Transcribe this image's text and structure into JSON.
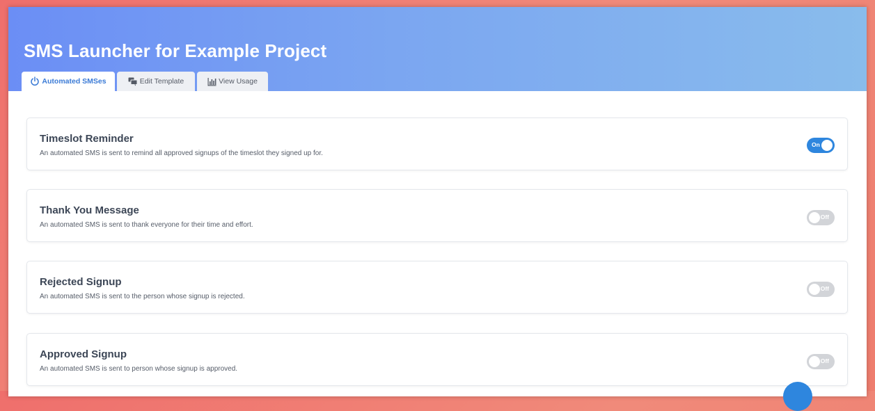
{
  "header": {
    "title": "SMS Launcher for Example Project"
  },
  "tabs": [
    {
      "label": "Automated SMSes",
      "icon": "power-icon",
      "active": true
    },
    {
      "label": "Edit Template",
      "icon": "message-icon",
      "active": false
    },
    {
      "label": "View Usage",
      "icon": "bar-chart-icon",
      "active": false
    }
  ],
  "automations": [
    {
      "title": "Timeslot Reminder",
      "description": "An automated SMS is sent to remind all approved signups of the timeslot they signed up for.",
      "toggle_label": "On",
      "enabled": true
    },
    {
      "title": "Thank You Message",
      "description": "An automated SMS is sent to thank everyone for their time and effort.",
      "toggle_label": "Off",
      "enabled": false
    },
    {
      "title": "Rejected Signup",
      "description": "An automated SMS is sent to the person whose signup is rejected.",
      "toggle_label": "Off",
      "enabled": false
    },
    {
      "title": "Approved Signup",
      "description": "An automated SMS is sent to person whose signup is approved.",
      "toggle_label": "Off",
      "enabled": false
    }
  ],
  "colors": {
    "accent": "#2e86de",
    "toggle_off": "#d2d4d8",
    "header_start": "#6b8ef5",
    "header_end": "#89bcec"
  }
}
